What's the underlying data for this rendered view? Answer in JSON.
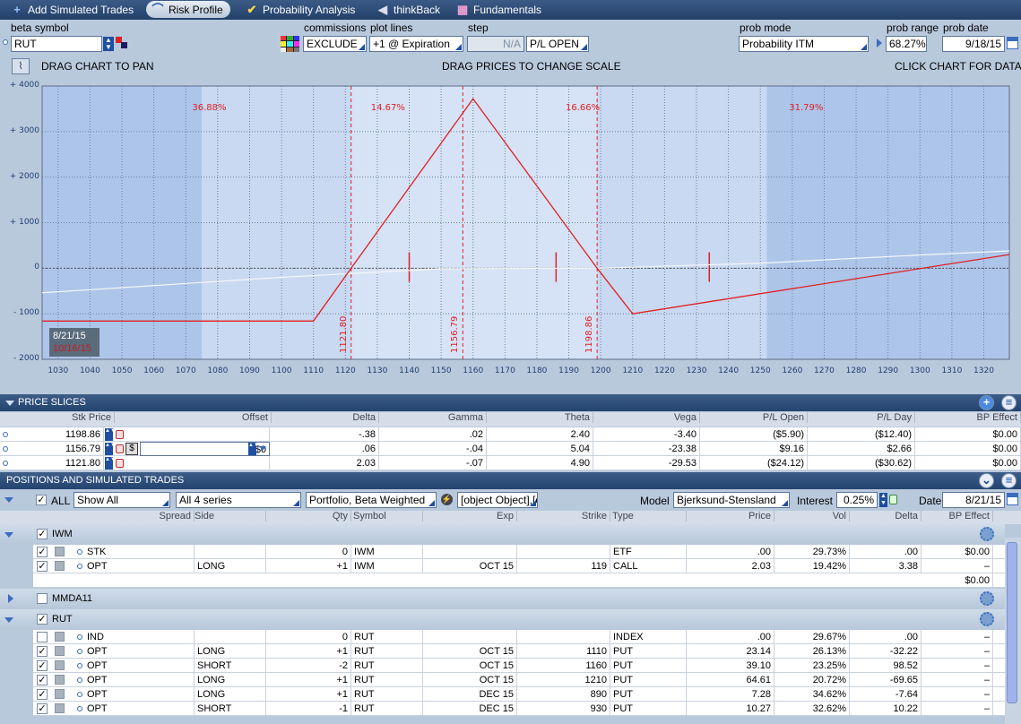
{
  "tabs": [
    {
      "label": "Add Simulated Trades",
      "icon": "plus-icon"
    },
    {
      "label": "Risk Profile",
      "icon": "risk-profile-icon"
    },
    {
      "label": "Probability Analysis",
      "icon": "probability-icon"
    },
    {
      "label": "thinkBack",
      "icon": "thinkback-icon"
    },
    {
      "label": "Fundamentals",
      "icon": "fundamentals-icon"
    }
  ],
  "controls": {
    "beta_symbol_label": "beta symbol",
    "beta_symbol": "RUT",
    "commissions_label": "commissions",
    "commissions": "EXCLUDE",
    "plot_lines_label": "plot lines",
    "plot_lines": "+1 @ Expiration",
    "step_label": "step",
    "step": "N/A",
    "pl_open": "P/L OPEN",
    "prob_mode_label": "prob mode",
    "prob_mode": "Probability ITM",
    "prob_range_label": "prob range",
    "prob_range": "68.27%",
    "prob_date_label": "prob date",
    "prob_date": "9/18/15"
  },
  "chartbar": {
    "left": "DRAG CHART TO PAN",
    "center": "DRAG PRICES TO CHANGE SCALE",
    "right": "CLICK CHART FOR DATA"
  },
  "chart_data": {
    "type": "line",
    "xlim": [
      1025,
      1328
    ],
    "ylim": [
      -2000,
      4000
    ],
    "x_ticks": [
      "1030",
      "1040",
      "1050",
      "1060",
      "1070",
      "1080",
      "1090",
      "1100",
      "1110",
      "1120",
      "1130",
      "1140",
      "1150",
      "1160",
      "1170",
      "1180",
      "1190",
      "1200",
      "1210",
      "1220",
      "1230",
      "1240",
      "1250",
      "1260",
      "1270",
      "1280",
      "1290",
      "1300",
      "1310",
      "1320"
    ],
    "y_ticks": [
      "+ 4000",
      "+ 3000",
      "+ 2000",
      "+ 1000",
      "0",
      "- 1000",
      "- 2000"
    ],
    "series": [
      {
        "x": [
          1025,
          1110,
          1121.8,
          1160,
          1198.86,
          1210,
          1328
        ],
        "y": [
          -1160,
          -1160,
          0,
          3720,
          0,
          -1000,
          300
        ]
      },
      {
        "x": [
          1025,
          1100,
          1150,
          1200,
          1250,
          1300,
          1328
        ],
        "y": [
          -540,
          -200,
          -10,
          0,
          110,
          290,
          380
        ]
      }
    ],
    "vlines": [
      {
        "x": 1121.8,
        "label": "1121.80"
      },
      {
        "x": 1156.79,
        "label": "1156.79"
      },
      {
        "x": 1198.86,
        "label": "1198.86"
      }
    ],
    "prob_regions": [
      "36.88%",
      "14.67%",
      "16.66%",
      "31.79%"
    ],
    "date_labels": [
      "8/21/15",
      "10/16/15"
    ]
  },
  "price_slices": {
    "title": "PRICE SLICES",
    "headers": [
      "Stk Price",
      "Offset",
      "Delta",
      "Gamma",
      "Theta",
      "Vega",
      "P/L Open",
      "P/L Day",
      "BP Effect"
    ],
    "rows": [
      [
        "1198.86",
        "",
        "-.38",
        ".02",
        "2.40",
        "-3.40",
        "($5.90)",
        "($12.40)",
        "$0.00"
      ],
      [
        "1156.79",
        "$0",
        ".06",
        "-.04",
        "5.04",
        "-23.38",
        "$9.16",
        "$2.66",
        "$0.00"
      ],
      [
        "1121.80",
        "",
        "2.03",
        "-.07",
        "4.90",
        "-29.53",
        "($24.12)",
        "($30.62)",
        "$0.00"
      ]
    ]
  },
  "positions": {
    "title": "POSITIONS AND SIMULATED TRADES",
    "all_label": "ALL",
    "show": "Show All",
    "series": "All 4 series",
    "portfolio": "Portfolio, Beta Weighted",
    "groups": [
      {
        "name": "IWM",
        "rows": [
          [
            "STK",
            "",
            "0",
            "IWM",
            "",
            "",
            "ETF",
            ".00",
            "29.73%",
            ".00",
            "$0.00"
          ],
          [
            "OPT",
            "LONG",
            "+1",
            "IWM",
            "OCT 15",
            "119",
            "CALL",
            "2.03",
            "19.42%",
            "3.38",
            "–"
          ]
        ],
        "total": "$0.00"
      },
      {
        "name": "MMDA11"
      },
      {
        "name": "RUT",
        "rows": [
          [
            "IND",
            "",
            "0",
            "RUT",
            "",
            "",
            "INDEX",
            ".00",
            "29.67%",
            ".00",
            "–"
          ],
          [
            "OPT",
            "LONG",
            "+1",
            "RUT",
            "OCT 15",
            "1110",
            "PUT",
            "23.14",
            "26.13%",
            "-32.22",
            "–"
          ],
          [
            "OPT",
            "SHORT",
            "-2",
            "RUT",
            "OCT 15",
            "1160",
            "PUT",
            "39.10",
            "23.25%",
            "98.52",
            "–"
          ],
          [
            "OPT",
            "LONG",
            "+1",
            "RUT",
            "OCT 15",
            "1210",
            "PUT",
            "64.61",
            "20.72%",
            "-69.65",
            "–"
          ],
          [
            "OPT",
            "LONG",
            "+1",
            "RUT",
            "DEC 15",
            "890",
            "PUT",
            "7.28",
            "34.62%",
            "-7.64",
            "–"
          ],
          [
            "OPT",
            "SHORT",
            "-1",
            "RUT",
            "DEC 15",
            "930",
            "PUT",
            "10.27",
            "32.62%",
            "10.22",
            "–"
          ]
        ]
      }
    ],
    "model_label": "Model",
    "model": "Bjerksund-Stensland",
    "interest_label": "Interest",
    "interest": "0.25%",
    "date_label": "Date",
    "date": "8/21/15",
    "headers": [
      "Spread",
      "Side",
      "Qty",
      "Symbol",
      "Exp",
      "Strike",
      "Type",
      "Price",
      "Vol",
      "Delta",
      "BP Effect"
    ]
  }
}
